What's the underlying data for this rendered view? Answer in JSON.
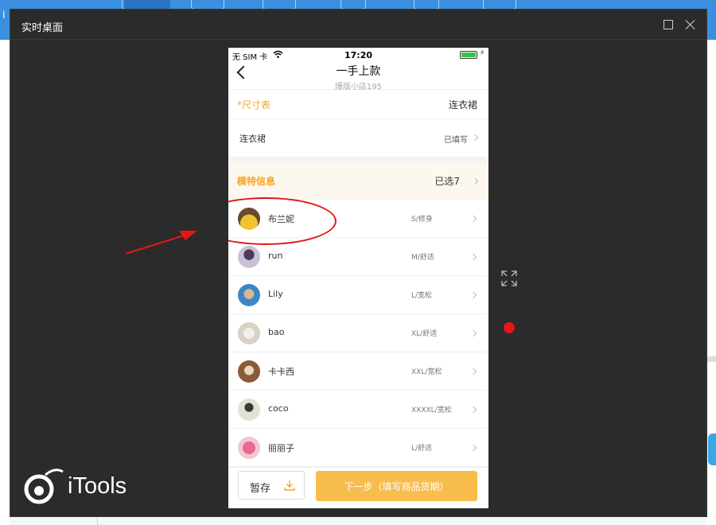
{
  "window": {
    "title": "实时桌面",
    "logo_text": "iTools"
  },
  "phone": {
    "status": {
      "carrier": "无 SIM 卡",
      "time": "17:20"
    },
    "nav": {
      "title": "一手上款",
      "subtitle": "爆版小店195"
    },
    "size_table": {
      "label": "*尺寸表",
      "value": "连衣裙"
    },
    "dress_row": {
      "label": "连衣裙",
      "value": "已填写"
    },
    "model_info": {
      "label": "模特信息",
      "value": "已选7"
    },
    "models": [
      {
        "name": "布兰妮",
        "fit": "S/修身"
      },
      {
        "name": "run",
        "fit": "M/舒适"
      },
      {
        "name": "Lily",
        "fit": "L/宽松"
      },
      {
        "name": "bao",
        "fit": "XL/舒适"
      },
      {
        "name": "卡卡西",
        "fit": "XXL/宽松"
      },
      {
        "name": "coco",
        "fit": "XXXXL/宽松"
      },
      {
        "name": "丽丽子",
        "fit": "L/舒适"
      }
    ],
    "buttons": {
      "save": "暂存",
      "next": "下一步（填写商品货期）"
    }
  },
  "colors": {
    "accent_orange": "#f5a623",
    "next_button": "#f9bd4c",
    "annotation_red": "#e31717",
    "window_bg": "#2b2b2b"
  },
  "icons": [
    "back-chevron-icon",
    "wifi-icon",
    "battery-icon",
    "download-icon",
    "expand-icon",
    "close-icon",
    "maximize-icon"
  ]
}
